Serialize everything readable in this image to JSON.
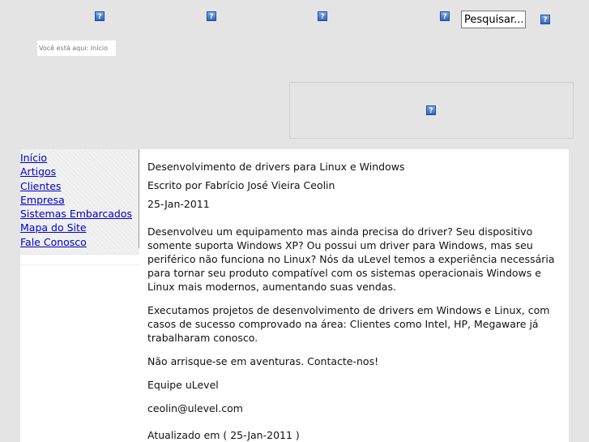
{
  "header": {
    "icons": [
      "broken-image-icon",
      "broken-image-icon",
      "broken-image-icon",
      "broken-image-icon",
      "broken-image-icon"
    ],
    "icon_glyph": "?",
    "search": {
      "placeholder": "Pesquisar...",
      "value": "Pesquisar..."
    }
  },
  "breadcrumb": {
    "text": "Você está aqui: Início"
  },
  "banner": {
    "icon": "broken-image-icon",
    "glyph": "?"
  },
  "sidebar": {
    "items": [
      {
        "label": "Início"
      },
      {
        "label": "Artigos"
      },
      {
        "label": "Clientes"
      },
      {
        "label": "Empresa"
      },
      {
        "label": "Sistemas Embarcados"
      },
      {
        "label": "Mapa do Site"
      },
      {
        "label": "Fale Conosco"
      }
    ]
  },
  "article": {
    "title": "Desenvolvimento de drivers para Linux e Windows",
    "author": "Escrito por Fabrício José Vieira Ceolin",
    "date": "25-Jan-2011",
    "p1": "Desenvolveu um equipamento mas ainda precisa do driver? Seu dispositivo somente suporta Windows XP? Ou possui um driver para Windows, mas seu periférico não funciona no Linux? Nós da uLevel temos a experiência necessária para tornar seu produto compatível com os sistemas operacionais Windows e Linux mais modernos, aumentando suas vendas.",
    "p2": "Executamos projetos de desenvolvimento de drivers em Windows e Linux, com casos de sucesso comprovado na área: Clientes como Intel, HP, Megaware já trabalharam conosco.",
    "p3": "Não arrisque-se em aventuras. Contacte-nos!",
    "p4": "Equipe uLevel",
    "p5": "ceolin@ulevel.com",
    "updated": "Atualizado em ( 25-Jan-2011 )"
  },
  "colors": {
    "background": "#e4e4e4",
    "link": "#0000cc",
    "icon": "#4a7fd1"
  }
}
